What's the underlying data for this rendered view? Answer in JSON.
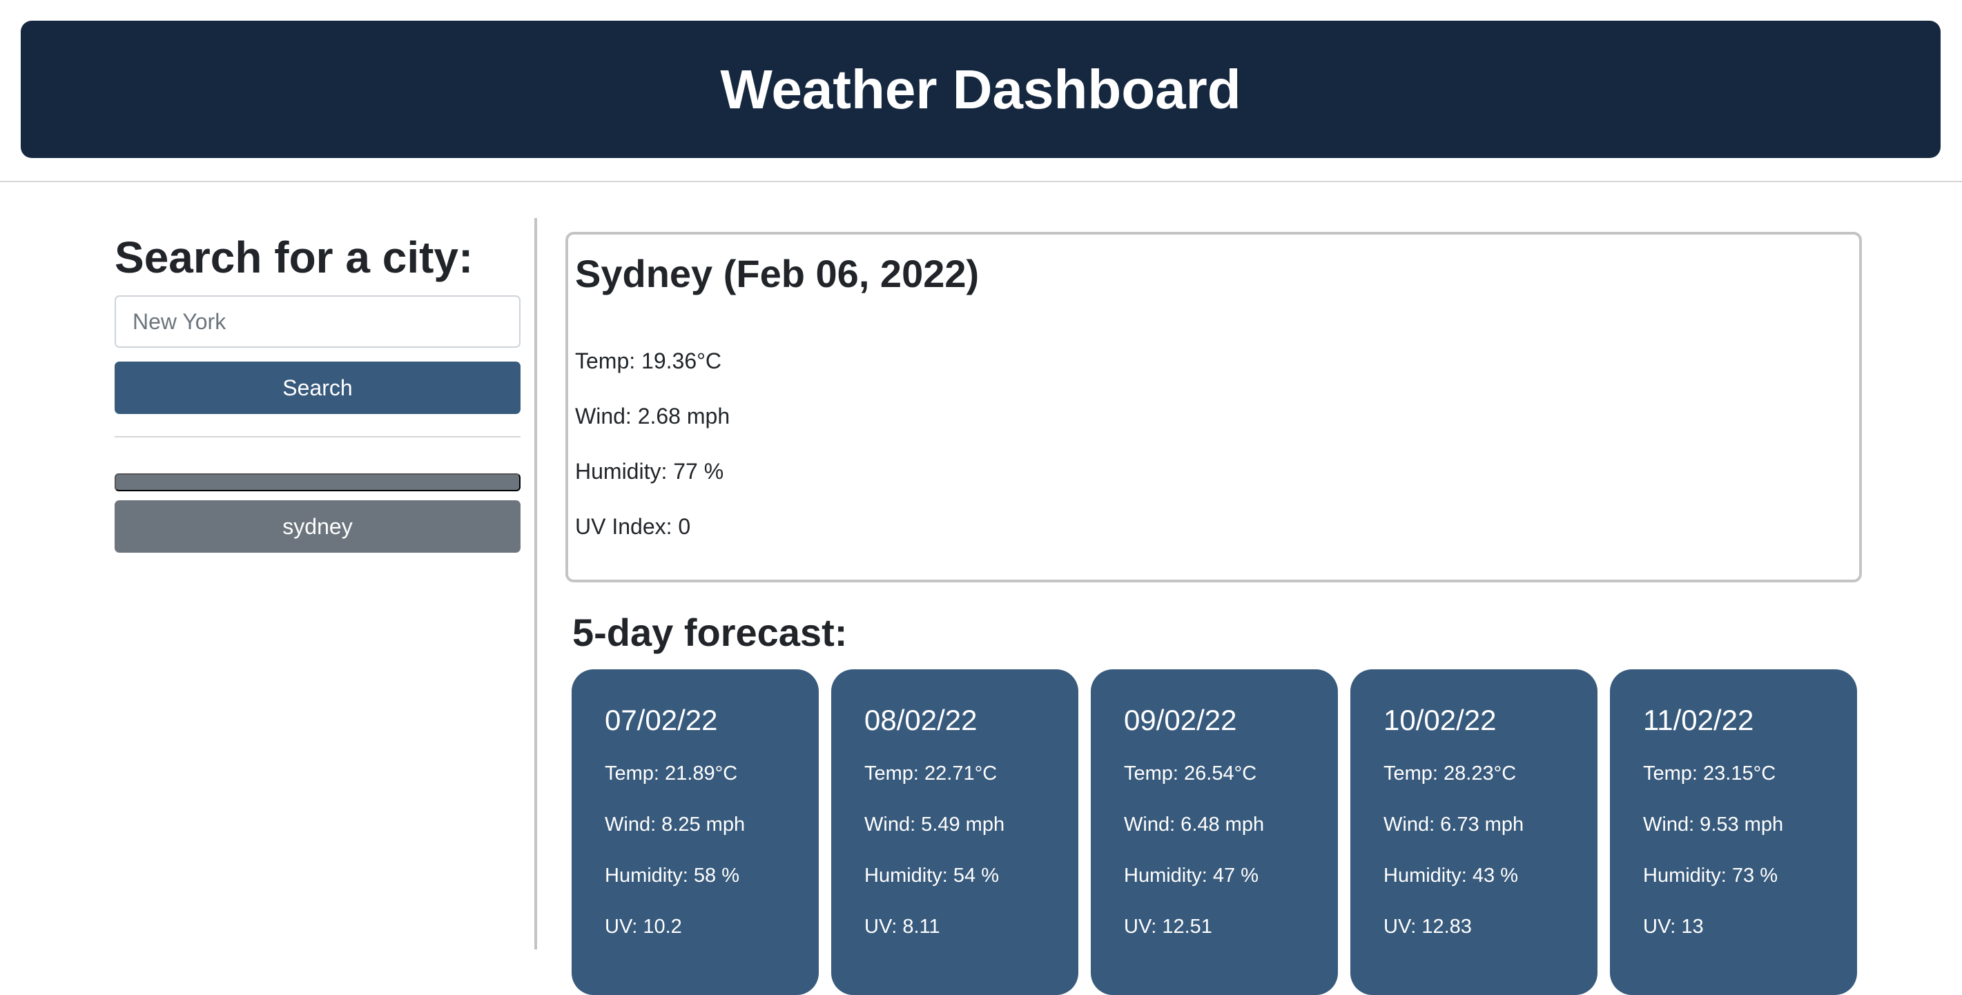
{
  "header": {
    "title": "Weather Dashboard"
  },
  "sidebar": {
    "heading": "Search for a city:",
    "search_placeholder": "New York",
    "search_value": "",
    "search_button": "Search",
    "history": [
      {
        "label": ""
      },
      {
        "label": "sydney"
      }
    ]
  },
  "current": {
    "title": "Sydney (Feb 06, 2022)",
    "temp": "Temp: 19.36°C",
    "wind": "Wind: 2.68 mph",
    "humidity": "Humidity: 77 %",
    "uv": "UV Index: 0"
  },
  "forecast": {
    "heading": "5-day forecast:",
    "days": [
      {
        "date": "07/02/22",
        "temp": "Temp: 21.89°C",
        "wind": "Wind: 8.25 mph",
        "humidity": "Humidity: 58 %",
        "uv": "UV: 10.2"
      },
      {
        "date": "08/02/22",
        "temp": "Temp: 22.71°C",
        "wind": "Wind: 5.49 mph",
        "humidity": "Humidity: 54 %",
        "uv": "UV: 8.11"
      },
      {
        "date": "09/02/22",
        "temp": "Temp: 26.54°C",
        "wind": "Wind: 6.48 mph",
        "humidity": "Humidity: 47 %",
        "uv": "UV: 12.51"
      },
      {
        "date": "10/02/22",
        "temp": "Temp: 28.23°C",
        "wind": "Wind: 6.73 mph",
        "humidity": "Humidity: 43 %",
        "uv": "UV: 12.83"
      },
      {
        "date": "11/02/22",
        "temp": "Temp: 23.15°C",
        "wind": "Wind: 9.53 mph",
        "humidity": "Humidity: 73 %",
        "uv": "UV: 13"
      }
    ]
  },
  "colors": {
    "header_bg": "#16283f",
    "primary": "#385a7c",
    "history_button": "#6c757d",
    "border": "#c4c4c4"
  }
}
